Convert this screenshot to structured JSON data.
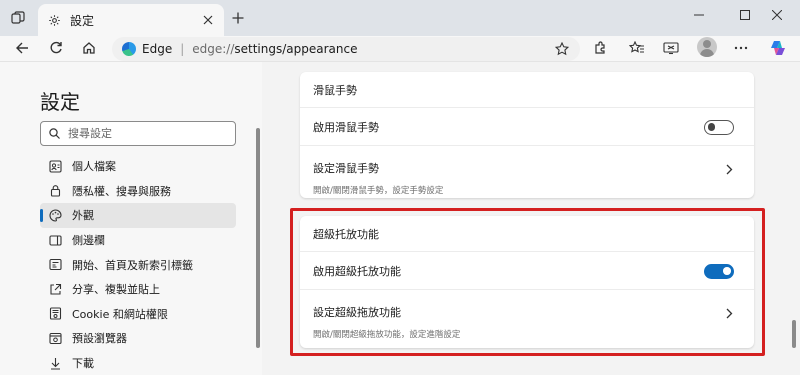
{
  "tab": {
    "title": "設定"
  },
  "address_bar": {
    "brand": "Edge",
    "separator": "|",
    "url_host": "edge://",
    "url_path": "settings/appearance"
  },
  "sidebar": {
    "title": "設定",
    "search_placeholder": "搜尋設定",
    "items": [
      {
        "label": "個人檔案",
        "icon": "profile-icon"
      },
      {
        "label": "隱私權、搜尋與服務",
        "icon": "lock-icon"
      },
      {
        "label": "外觀",
        "icon": "appearance-icon",
        "active": true
      },
      {
        "label": "側邊欄",
        "icon": "sidebar-icon"
      },
      {
        "label": "開始、首頁及新索引標籤",
        "icon": "home-icon"
      },
      {
        "label": "分享、複製並貼上",
        "icon": "share-icon"
      },
      {
        "label": "Cookie 和網站權限",
        "icon": "cookie-icon"
      },
      {
        "label": "預設瀏覽器",
        "icon": "browser-icon"
      },
      {
        "label": "下載",
        "icon": "download-icon"
      }
    ]
  },
  "mouse_gesture_card": {
    "heading": "滑鼠手勢",
    "enable_label": "啟用滑鼠手勢",
    "enable_on": false,
    "config_label": "設定滑鼠手勢",
    "config_desc": "開啟/關閉滑鼠手勢，設定手勢設定"
  },
  "super_drag_card": {
    "heading": "超級托放功能",
    "enable_label": "啟用超級托放功能",
    "enable_on": true,
    "config_label": "設定超級拖放功能",
    "config_desc": "開啟/關閉超級拖放功能，設定進階設定"
  },
  "colors": {
    "accent": "#0f6cbd",
    "highlight": "#d42020"
  }
}
